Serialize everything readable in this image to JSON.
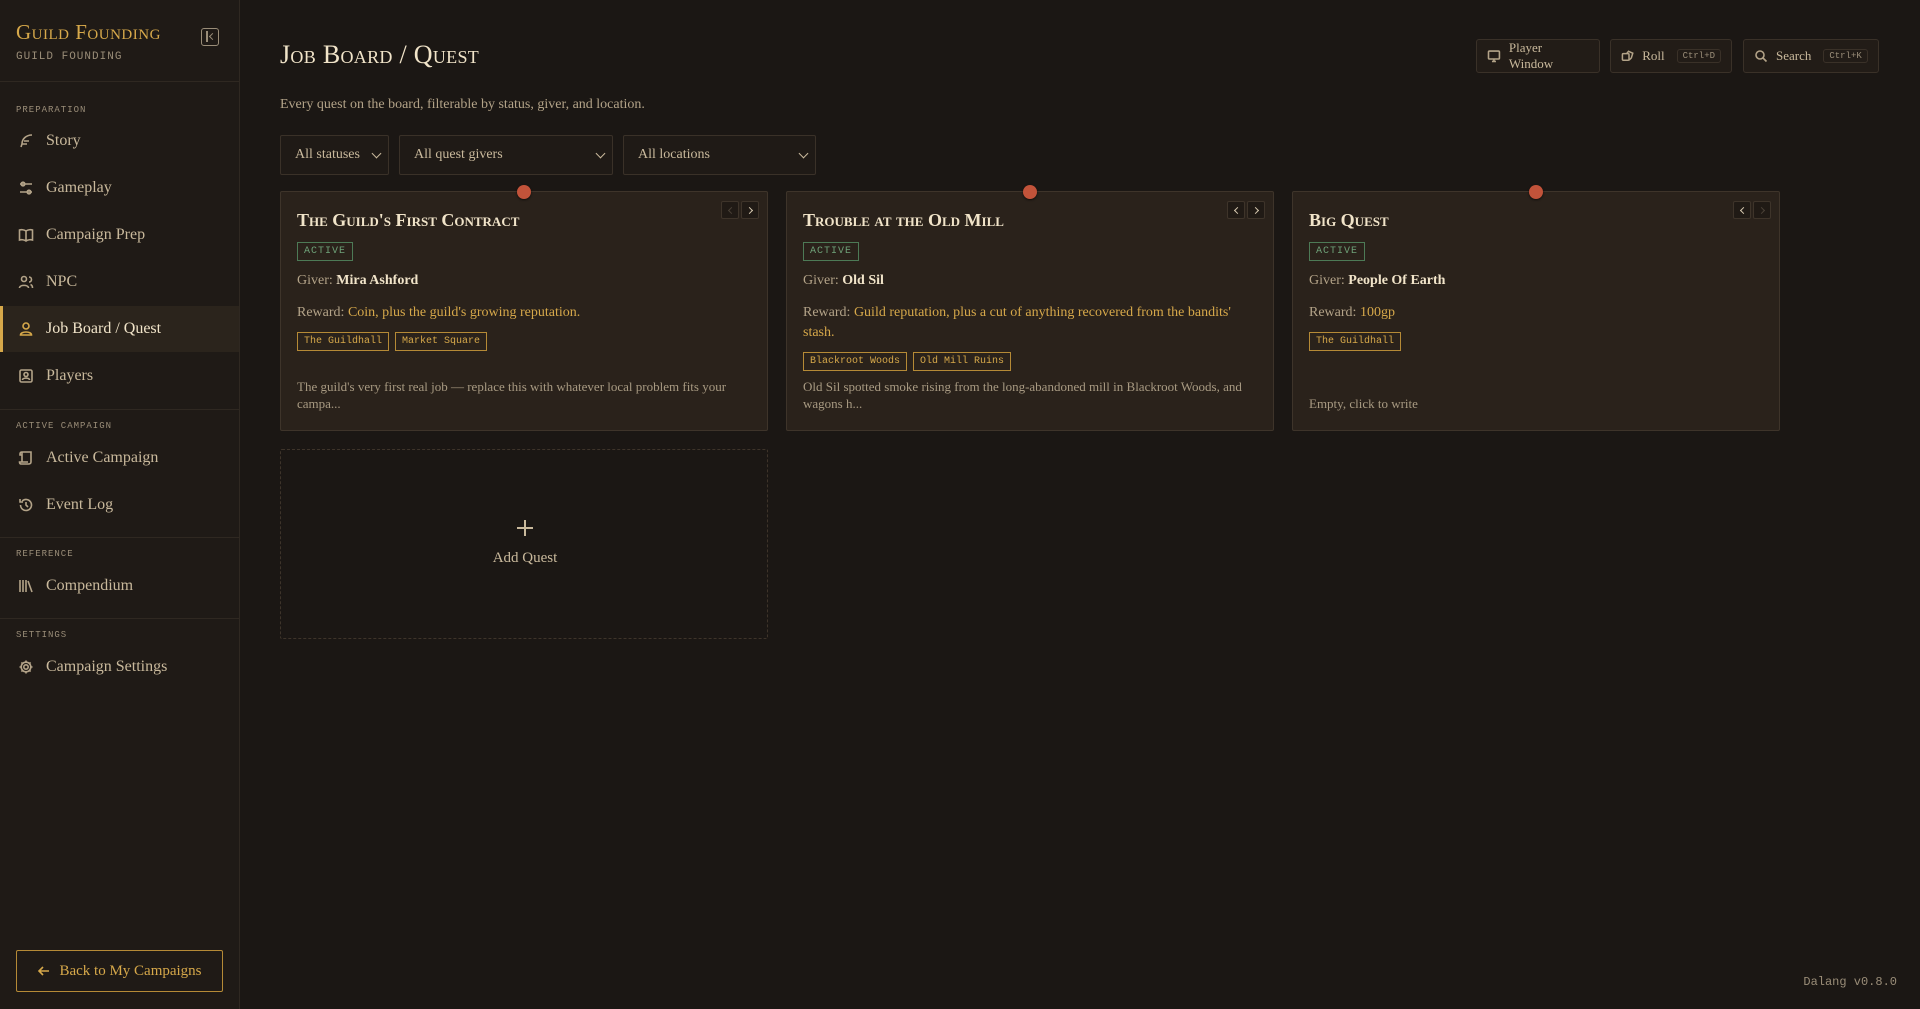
{
  "brand": {
    "title": "Guild Founding",
    "subtitle": "GUILD FOUNDING"
  },
  "sidebar": {
    "sections": [
      {
        "label": "PREPARATION"
      },
      {
        "label": "ACTIVE CAMPAIGN"
      },
      {
        "label": "REFERENCE"
      },
      {
        "label": "SETTINGS"
      }
    ],
    "items": [
      {
        "label": "Story",
        "icon": "feather-icon"
      },
      {
        "label": "Gameplay",
        "icon": "sliders-icon"
      },
      {
        "label": "Campaign Prep",
        "icon": "book-icon"
      },
      {
        "label": "NPC",
        "icon": "users-icon"
      },
      {
        "label": "Job Board / Quest",
        "icon": "quest-icon",
        "active": true
      },
      {
        "label": "Players",
        "icon": "player-icon"
      },
      {
        "label": "Active Campaign",
        "icon": "scroll-icon"
      },
      {
        "label": "Event Log",
        "icon": "history-icon"
      },
      {
        "label": "Compendium",
        "icon": "library-icon"
      },
      {
        "label": "Campaign Settings",
        "icon": "gear-icon"
      }
    ],
    "back_label": "Back to My Campaigns"
  },
  "header": {
    "title": "Job Board / Quest",
    "description": "Every quest on the board, filterable by status, giver, and location.",
    "player_window": "Player Window",
    "roll": "Roll",
    "roll_shortcut": "Ctrl+D",
    "search": "Search",
    "search_shortcut": "Ctrl+K"
  },
  "filters": {
    "status": "All statuses",
    "giver": "All quest givers",
    "location": "All locations"
  },
  "quests": [
    {
      "title": "The Guild's First Contract",
      "status": "ACTIVE",
      "giver_label": "Giver:",
      "giver": "Mira Ashford",
      "reward_label": "Reward:",
      "reward": "Coin, plus the guild's growing reputation.",
      "tags": [
        "The Guildhall",
        "Market Square"
      ],
      "description": "The guild's very first real job — replace this with whatever local problem fits your campa..."
    },
    {
      "title": "Trouble at the Old Mill",
      "status": "ACTIVE",
      "giver_label": "Giver:",
      "giver": "Old Sil",
      "reward_label": "Reward:",
      "reward": "Guild reputation, plus a cut of anything recovered from the bandits' stash.",
      "tags": [
        "Blackroot Woods",
        "Old Mill Ruins"
      ],
      "description": "Old Sil spotted smoke rising from the long-abandoned mill in Blackroot Woods, and wagons h..."
    },
    {
      "title": "Big Quest",
      "status": "ACTIVE",
      "giver_label": "Giver:",
      "giver": "People Of Earth",
      "reward_label": "Reward:",
      "reward": "100gp",
      "tags": [
        "The Guildhall"
      ],
      "description": "Empty, click to write"
    }
  ],
  "add_quest_label": "Add Quest",
  "version": "Dalang v0.8.0",
  "colors": {
    "accent": "#d6a84a",
    "pin": "#c2533a",
    "status_active": "#6ea178",
    "background": "#1b1714"
  }
}
